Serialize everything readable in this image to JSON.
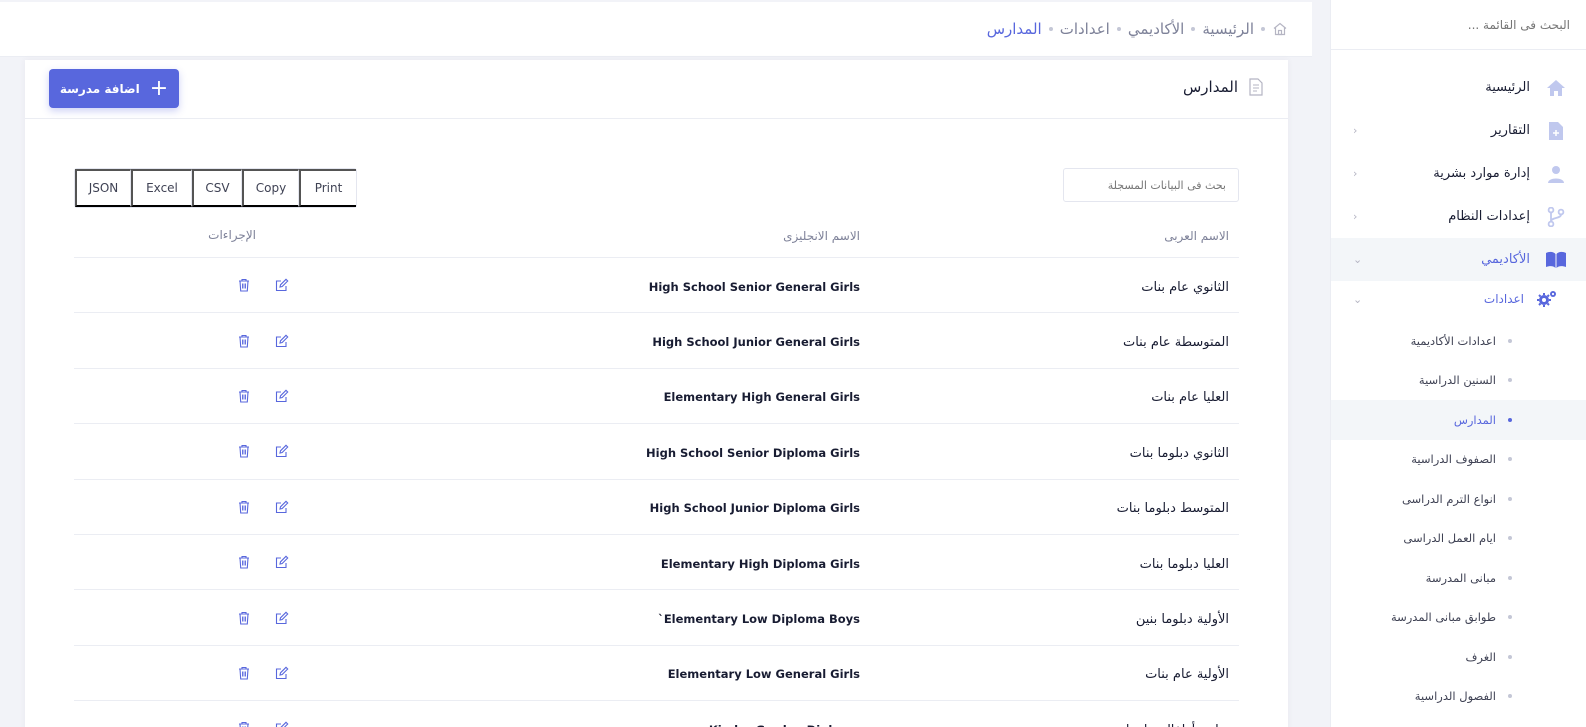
{
  "sidebar": {
    "search_placeholder": "البحث فى القائمة ...",
    "items": [
      {
        "label": "الرئيسية",
        "icon": "home-icon"
      },
      {
        "label": "التقارير",
        "icon": "report-icon",
        "arrow": "‹"
      },
      {
        "label": "إدارة موارد بشرية",
        "icon": "users-icon",
        "arrow": "‹"
      },
      {
        "label": "إعدادات النظام",
        "icon": "git-branch-icon",
        "arrow": "‹"
      },
      {
        "label": "الأكاديمي",
        "icon": "book-icon",
        "arrow": "⌄"
      }
    ],
    "sub": {
      "label": "اعدادات",
      "icon": "gears-icon",
      "arrow": "⌄"
    },
    "leaves": [
      "اعدادات الأكاديمية",
      "السنين الدراسية",
      "المدارس",
      "الصفوف الدراسية",
      "انواع الترم الدراسى",
      "ايام العمل الدراسى",
      "مبانى المدرسة",
      "طوابق مبانى المدرسة",
      "الغرف",
      "الفصول الدراسية"
    ]
  },
  "breadcrumb": {
    "items": [
      "الرئيسية",
      "الأكاديمي",
      "اعدادات",
      "المدارس"
    ]
  },
  "card": {
    "title": "المدارس",
    "add_button": "اضافة مدرسة"
  },
  "tools": [
    "Print",
    "Copy",
    "CSV",
    "Excel",
    "JSON"
  ],
  "table_search_placeholder": "بحث فى البيانات المسجلة",
  "table": {
    "headers": {
      "arabic": "الاسم العربى",
      "english": "الاسم الانجليزى",
      "actions": "الإجراءات"
    },
    "rows": [
      {
        "ar": "الثانوي عام بنات",
        "en": "High School Senior General Girls"
      },
      {
        "ar": "المتوسطة عام بنات",
        "en": "High School Junior General Girls"
      },
      {
        "ar": "العليا عام بنات",
        "en": "Elementary High General Girls"
      },
      {
        "ar": "الثانوي دبلوما بنات",
        "en": "High School Senior Diploma Girls"
      },
      {
        "ar": "المتوسط دبلوما بنات",
        "en": "High School Junior Diploma Girls"
      },
      {
        "ar": "العليا دبلوما بنات",
        "en": "Elementary High Diploma Girls"
      },
      {
        "ar": "الأولية دبلوما بنين",
        "en": "Elementary Low Diploma Boys`"
      },
      {
        "ar": "الأولية عام بنات",
        "en": "Elementary Low General Girls"
      },
      {
        "ar": "رياض أطفال دبلوما",
        "en": "Kinder Garden Diploma"
      }
    ]
  },
  "colors": {
    "accent": "#5867dd",
    "text": "#181c32",
    "muted": "#7e8299"
  }
}
